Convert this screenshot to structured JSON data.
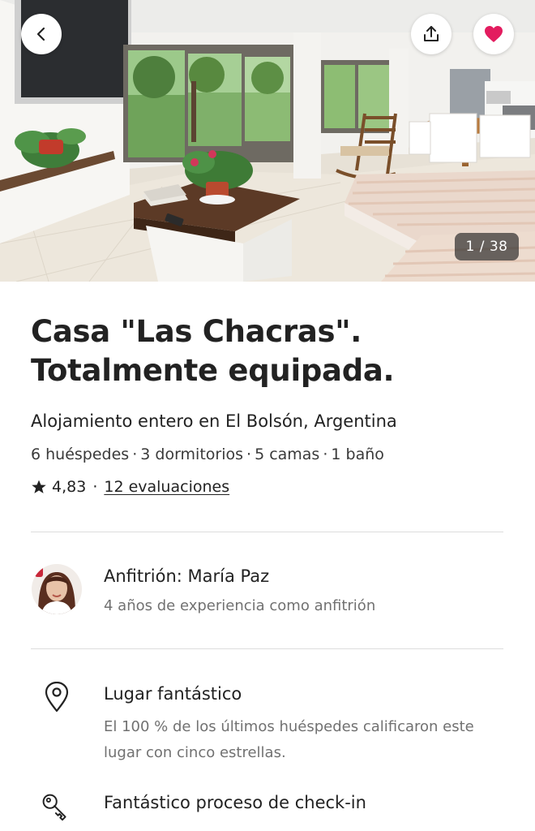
{
  "header": {
    "back_icon": "chevron-left-icon",
    "share_icon": "share-icon",
    "favorite_icon": "heart-icon",
    "favorite_color": "#e31c5f",
    "photo_counter": "1 / 38"
  },
  "listing": {
    "title": "Casa \"Las Chacras\". Totalmente equipada.",
    "subtitle": "Alojamiento entero en El Bolsón, Argentina",
    "details": [
      "6 huéspedes",
      "3 dormitorios",
      "5 camas",
      "1 baño"
    ],
    "detail_separator": "·",
    "rating": "4,83",
    "rating_separator": "·",
    "reviews_label": "12 evaluaciones"
  },
  "host": {
    "name_label": "Anfitrión: María Paz",
    "experience": "4 años de experiencia como anfitrión"
  },
  "highlights": [
    {
      "icon": "location-pin-icon",
      "title": "Lugar fantástico",
      "description": "El 100 % de los últimos huéspedes calificaron este lugar con cinco estrellas."
    },
    {
      "icon": "key-icon",
      "title": "Fantástico proceso de check-in"
    }
  ]
}
